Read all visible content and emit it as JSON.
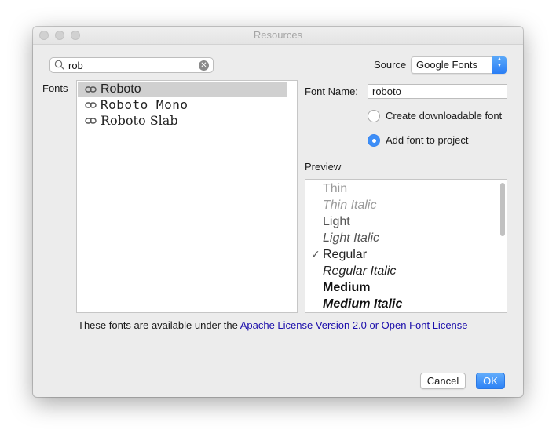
{
  "window": {
    "title": "Resources"
  },
  "search": {
    "value": "rob",
    "icon": "search-icon",
    "clear_icon": "clear-icon"
  },
  "source": {
    "label": "Source",
    "selected": "Google Fonts"
  },
  "fonts": {
    "label": "Fonts",
    "items": [
      {
        "name": "Roboto",
        "selected": true
      },
      {
        "name": "Roboto Mono",
        "selected": false
      },
      {
        "name": "Roboto Slab",
        "selected": false
      }
    ]
  },
  "font_name": {
    "label": "Font Name:",
    "value": "roboto"
  },
  "options": {
    "create_downloadable": {
      "label": "Create downloadable font",
      "checked": false
    },
    "add_to_project": {
      "label": "Add font to project",
      "checked": true
    }
  },
  "preview": {
    "label": "Preview",
    "styles": [
      {
        "name": "Thin",
        "checked": false
      },
      {
        "name": "Thin Italic",
        "checked": false
      },
      {
        "name": "Light",
        "checked": false
      },
      {
        "name": "Light Italic",
        "checked": false
      },
      {
        "name": "Regular",
        "checked": true
      },
      {
        "name": "Regular Italic",
        "checked": false
      },
      {
        "name": "Medium",
        "checked": false
      },
      {
        "name": "Medium Italic",
        "checked": false
      }
    ]
  },
  "license": {
    "text": "These fonts are available under the",
    "link": "Apache License Version 2.0 or Open Font License"
  },
  "buttons": {
    "cancel": "Cancel",
    "ok": "OK"
  },
  "colors": {
    "accent": "#2d82f6",
    "link": "#1a0dab",
    "selection": "#d0d0d0"
  }
}
